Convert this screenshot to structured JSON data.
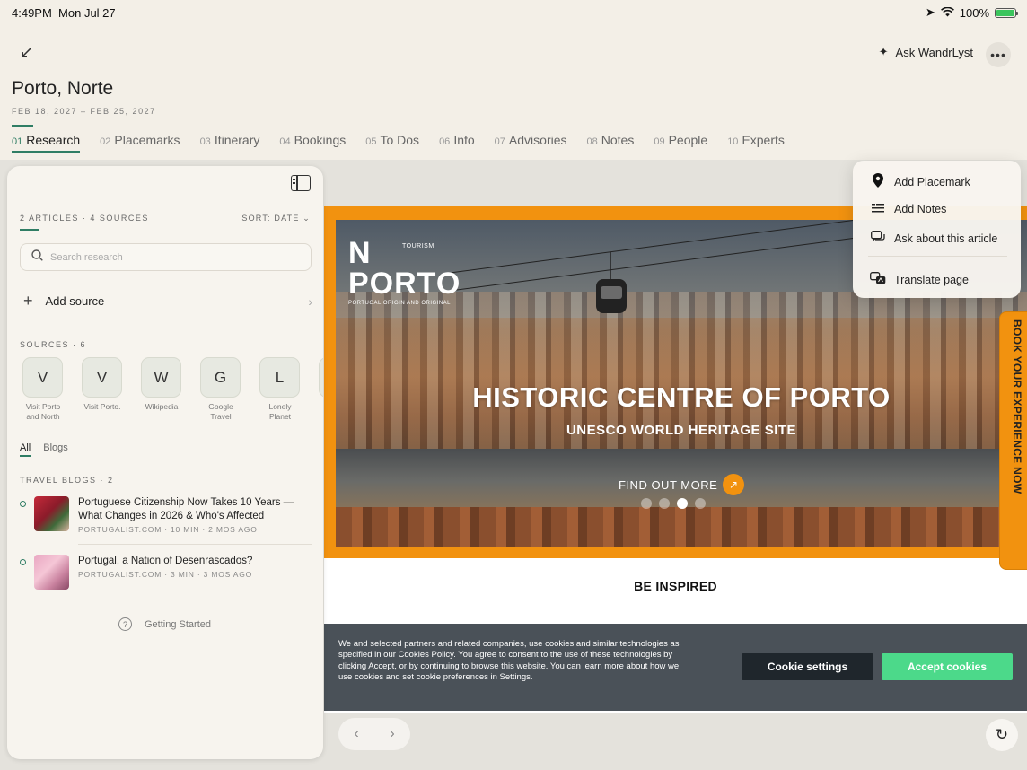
{
  "status_bar": {
    "time": "4:49PM",
    "date": "Mon Jul 27",
    "battery": "100%",
    "battery_level": 1.0
  },
  "header": {
    "ask_label": "Ask WandrLyst",
    "more_label": "•••"
  },
  "trip": {
    "title": "Porto, Norte",
    "dates": "FEB 18, 2027 – FEB 25, 2027"
  },
  "tabs": [
    {
      "num": "01",
      "label": "Research",
      "active": true
    },
    {
      "num": "02",
      "label": "Placemarks"
    },
    {
      "num": "03",
      "label": "Itinerary"
    },
    {
      "num": "04",
      "label": "Bookings"
    },
    {
      "num": "05",
      "label": "To Dos"
    },
    {
      "num": "06",
      "label": "Info"
    },
    {
      "num": "07",
      "label": "Advisories"
    },
    {
      "num": "08",
      "label": "Notes"
    },
    {
      "num": "09",
      "label": "People"
    },
    {
      "num": "10",
      "label": "Experts"
    }
  ],
  "research": {
    "summary": "2 ARTICLES · 4 SOURCES",
    "sort": "SORT: DATE ⌄",
    "search_placeholder": "Search research",
    "add_source": "Add source",
    "sources_label": "SOURCES · 6",
    "sources": [
      {
        "letter": "V",
        "name": "Visit Porto and North"
      },
      {
        "letter": "V",
        "name": "Visit Porto."
      },
      {
        "letter": "W",
        "name": "Wikipedia"
      },
      {
        "letter": "G",
        "name": "Google Travel"
      },
      {
        "letter": "L",
        "name": "Lonely Planet"
      },
      {
        "letter": "",
        "name": ""
      }
    ],
    "filters": {
      "all": "All",
      "blogs": "Blogs"
    },
    "blogs_label": "TRAVEL BLOGS · 2",
    "articles": [
      {
        "title": "Portuguese Citizenship Now Takes 10 Years — What Changes in 2026 & Who's Affected",
        "meta": "PORTUGALIST.COM · 10 MIN · 2 MOS AGO"
      },
      {
        "title": "Portugal, a Nation of Desenrascados?",
        "meta": "PORTUGALIST.COM · 3 MIN · 3 MOS AGO"
      }
    ],
    "getting_started": "Getting Started"
  },
  "web": {
    "logo_text": "PORTO",
    "logo_n": "N",
    "logo_tourism": "TOURISM",
    "logo_tag": "PORTUGAL ORIGIN AND ORIGINAL",
    "hero_title": "HISTORIC CENTRE OF PORTO",
    "hero_subtitle": "UNESCO WORLD HERITAGE SITE",
    "find_more": "FIND OUT MORE",
    "book_tab": "BOOK YOUR EXPERIENCE NOW",
    "be_inspired": "BE INSPIRED",
    "cookie_text": "We and selected partners and related companies, use cookies and similar technologies as specified in our Cookies Policy. You agree to consent to the use of these technologies by clicking Accept, or by continuing to browse this website. You can learn more about how we use cookies and set cookie preferences in Settings.",
    "cookie_settings": "Cookie settings",
    "accept_cookies": "Accept cookies",
    "carousel_active_index": 2,
    "carousel_count": 4
  },
  "context_menu": {
    "items": [
      {
        "label": "Add Placemark",
        "icon": "pin-icon"
      },
      {
        "label": "Add Notes",
        "icon": "notes-icon"
      },
      {
        "label": "Ask about this article",
        "icon": "chat-icon"
      },
      {
        "label": "Translate page",
        "icon": "translate-icon"
      }
    ]
  },
  "colors": {
    "accent": "#2f7d64",
    "brand_orange": "#f2920f",
    "accept_green": "#4cd98a",
    "cookie_bg": "#4a5158"
  }
}
